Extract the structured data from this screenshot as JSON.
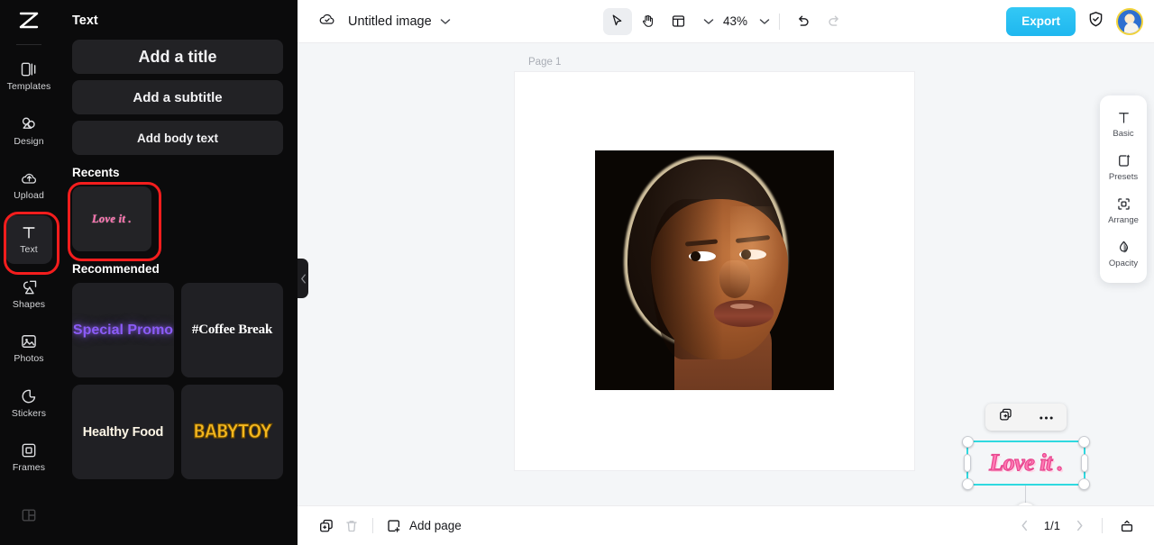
{
  "app": {
    "logo_icon": "capcut-logo-icon"
  },
  "rail": {
    "items": [
      {
        "label": "Templates",
        "icon": "templates-icon"
      },
      {
        "label": "Design",
        "icon": "design-icon"
      },
      {
        "label": "Upload",
        "icon": "upload-cloud-icon"
      },
      {
        "label": "Text",
        "icon": "text-t-icon"
      },
      {
        "label": "Shapes",
        "icon": "shapes-icon"
      },
      {
        "label": "Photos",
        "icon": "photos-icon"
      },
      {
        "label": "Stickers",
        "icon": "stickers-icon"
      },
      {
        "label": "Frames",
        "icon": "frames-icon"
      }
    ],
    "active_index": 3,
    "highlight_index": 3,
    "highlight_color": "#f41d1d",
    "bottom_icon": "layout-grid-icon"
  },
  "panel": {
    "title": "Text",
    "buttons": [
      {
        "label": "Add a title"
      },
      {
        "label": "Add a subtitle"
      },
      {
        "label": "Add body text"
      }
    ],
    "recents": {
      "heading": "Recents",
      "items": [
        {
          "label": "Love it ."
        }
      ],
      "highlighted": true
    },
    "recommended": {
      "heading": "Recommended",
      "items": [
        {
          "label": "Special Promo",
          "color": "#8b5cf6"
        },
        {
          "label": "#Coffee Break",
          "color": "#ffffff"
        },
        {
          "label": "Healthy Food",
          "color": "#fdf6e6"
        },
        {
          "label": "BABYTOY",
          "color": "#f5b820"
        }
      ]
    },
    "collapse_icon": "chevron-left-icon"
  },
  "topbar": {
    "cloud_icon": "cloud-saved-icon",
    "doc_title": "Untitled image",
    "title_caret_icon": "chevron-down-icon",
    "tools": [
      {
        "name": "select-tool",
        "icon": "cursor-arrow-icon",
        "selected": true
      },
      {
        "name": "hand-tool",
        "icon": "hand-icon",
        "selected": false
      },
      {
        "name": "layout-tool",
        "icon": "layout-panel-icon",
        "selected": false
      }
    ],
    "layout_caret_icon": "chevron-down-icon",
    "zoom_level": "43%",
    "zoom_caret_icon": "chevron-down-icon",
    "undo_icon": "undo-arrow-icon",
    "redo_icon": "redo-arrow-icon",
    "export_label": "Export",
    "shield_icon": "shield-check-icon",
    "avatar_icon": "user-avatar"
  },
  "canvas": {
    "page_label": "Page 1",
    "selected_text": "Love it .",
    "selection_color": "#2fd9e0",
    "text_fill": "#ff78b4",
    "text_stroke": "#e8478f",
    "context_toolbar": [
      {
        "name": "duplicate-button",
        "icon": "duplicate-icon"
      },
      {
        "name": "more-options-button",
        "icon": "ellipsis-icon"
      }
    ],
    "rotate_icon": "rotate-icon"
  },
  "right_panel": {
    "items": [
      {
        "label": "Basic",
        "icon": "text-t-icon"
      },
      {
        "label": "Presets",
        "icon": "presets-star-icon"
      },
      {
        "label": "Arrange",
        "icon": "arrange-icon"
      },
      {
        "label": "Opacity",
        "icon": "opacity-droplet-icon"
      }
    ]
  },
  "bottombar": {
    "duplicate_icon": "duplicate-page-icon",
    "delete_icon": "trash-icon",
    "add_page_label": "Add page",
    "add_page_icon": "add-page-icon",
    "prev_icon": "chevron-left-icon",
    "page_count": "1/1",
    "next_icon": "chevron-right-icon",
    "expand_icon": "expand-panel-icon"
  }
}
